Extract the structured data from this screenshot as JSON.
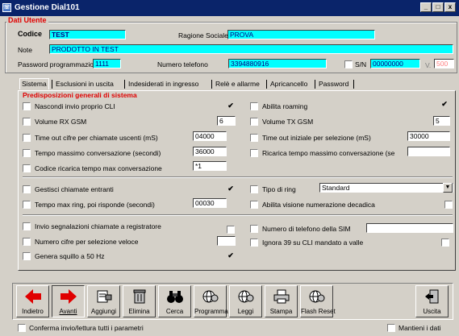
{
  "window": {
    "title": "Gestione Dial101",
    "controls": [
      "_",
      "□",
      "x"
    ]
  },
  "user_data": {
    "legend": "Dati Utente",
    "codice_label": "Codice",
    "codice_value": "TEST",
    "ragione_label": "Ragione Sociale",
    "ragione_value": "PROVA",
    "note_label": "Note",
    "note_value": "PRODOTTO IN TEST",
    "password_label": "Password programmazione",
    "password_value": "1111",
    "telefono_label": "Numero telefono",
    "telefono_value": "3394880916",
    "sn_label": "S/N",
    "sn_value": "00000000",
    "v_label": "V.",
    "v_value": "500"
  },
  "tabs": [
    "Sistema",
    "Esclusioni in uscita",
    "Indesiderati in ingresso",
    "Relè e allarme",
    "Apricancello",
    "Password"
  ],
  "active_tab": "Sistema",
  "section": {
    "legend": "Predisposizioni generali di sistema"
  },
  "left": {
    "nascondi": "Nascondi invio proprio CLI",
    "volrx": "Volume RX GSM",
    "volrx_value": "6",
    "timeout_uscenti": "Time out cifre per chiamate uscenti (mS)",
    "timeout_uscenti_value": "04000",
    "tempo_conv": "Tempo massimo conversazione (secondi)",
    "tempo_conv_value": "36000",
    "codice_ricarica": "Codice ricarica tempo max conversazione",
    "codice_ricarica_value": "*1",
    "gestisci": "Gestisci chiamate entranti",
    "tempo_ring": "Tempo max ring, poi risponde (secondi)",
    "tempo_ring_value": "00030",
    "invio_segn": "Invio segnalazioni chiamate a registratore",
    "numero_cifre": "Numero cifre per selezione veloce",
    "genera": "Genera squillo a 50 Hz"
  },
  "right": {
    "abilita_roaming": "Abilita roaming",
    "voltx": "Volume TX GSM",
    "voltx_value": "5",
    "timeout_iniziale": "Time out iniziale per selezione (mS)",
    "timeout_iniziale_value": "30000",
    "ricarica": "Ricarica tempo massimo conversazione (se",
    "tipo_ring": "Tipo di ring",
    "tipo_ring_value": "Standard",
    "abilita_visione": "Abilita visione numerazione decadica",
    "num_sim": "Numero di telefono della SIM",
    "ignora": "Ignora 39 su CLI mandato a valle"
  },
  "checks": {
    "check_mark": "✔"
  },
  "toolbar": {
    "indietro": "Indietro",
    "avanti": "Avanti",
    "aggiungi": "Aggiungi",
    "elimina": "Elimina",
    "cerca": "Cerca",
    "programma": "Programma",
    "leggi": "Leggi",
    "stampa": "Stampa",
    "flash_reset": "Flash Reset",
    "uscita": "Uscita"
  },
  "status": {
    "conferma": "Conferma invio/lettura tutti i parametri",
    "mantieni": "Mantieni i dati"
  },
  "colors": {
    "title_bar": "#0a246a",
    "highlight_field": "#00ffff",
    "legend_red": "#e00000",
    "arrow_red": "#e00000"
  }
}
